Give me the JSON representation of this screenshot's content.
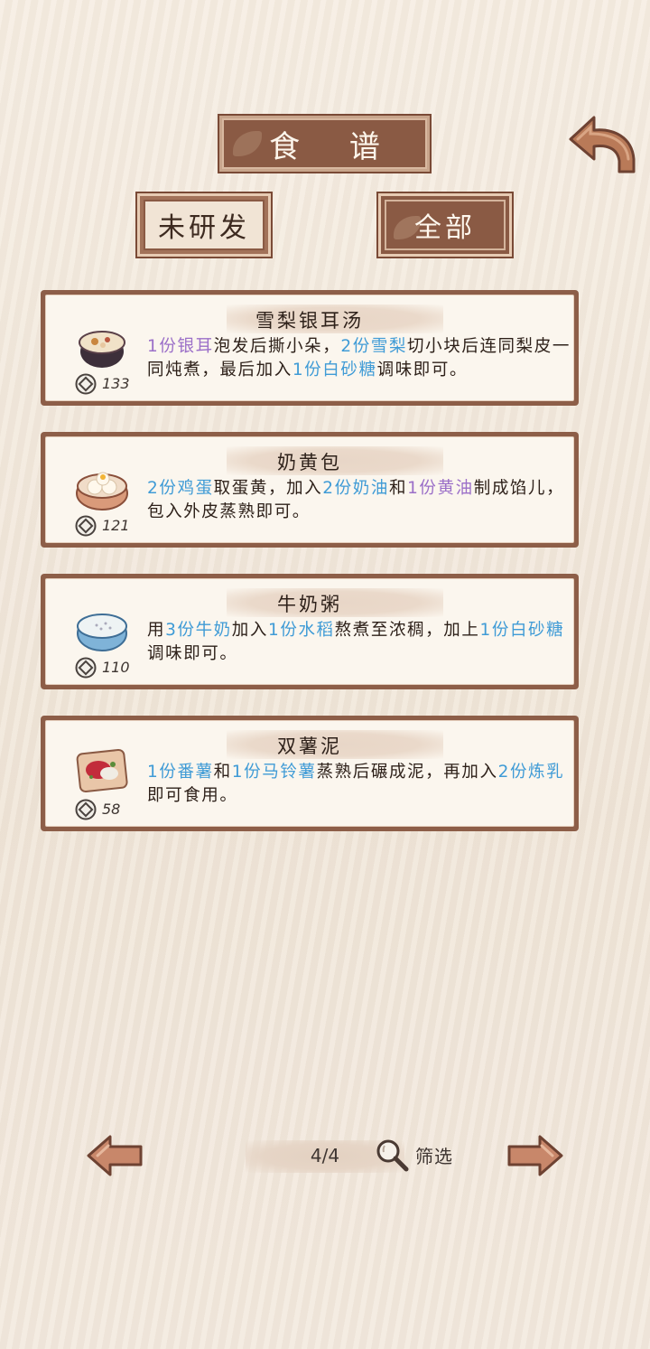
{
  "header": {
    "title": "食 谱",
    "back_icon": "back-arrow-icon"
  },
  "tabs": [
    {
      "label": "未研发",
      "active": false
    },
    {
      "label": "全部",
      "active": true
    }
  ],
  "recipes": [
    {
      "name": "雪梨银耳汤",
      "price": "133",
      "dish_icon": "soup-bowl-icon",
      "desc": [
        {
          "t": "1份银耳",
          "c": "purple"
        },
        {
          "t": "泡发后撕小朵，",
          "c": ""
        },
        {
          "t": "2份雪梨",
          "c": "blue"
        },
        {
          "t": "切小块后连同梨皮一同炖煮，最后加入",
          "c": ""
        },
        {
          "t": "1份白砂糖",
          "c": "blue"
        },
        {
          "t": "调味即可。",
          "c": ""
        }
      ]
    },
    {
      "name": "奶黄包",
      "price": "121",
      "dish_icon": "steamed-bun-icon",
      "desc": [
        {
          "t": "2份鸡蛋",
          "c": "blue"
        },
        {
          "t": "取蛋黄，加入",
          "c": ""
        },
        {
          "t": "2份奶油",
          "c": "blue"
        },
        {
          "t": "和",
          "c": ""
        },
        {
          "t": "1份黄油",
          "c": "purple"
        },
        {
          "t": "制成馅儿，包入外皮蒸熟即可。",
          "c": ""
        }
      ]
    },
    {
      "name": "牛奶粥",
      "price": "110",
      "dish_icon": "porridge-bowl-icon",
      "desc": [
        {
          "t": "用",
          "c": ""
        },
        {
          "t": "3份牛奶",
          "c": "blue"
        },
        {
          "t": "加入",
          "c": ""
        },
        {
          "t": "1份水稻",
          "c": "blue"
        },
        {
          "t": "熬煮至浓稠，加上",
          "c": ""
        },
        {
          "t": "1份白砂糖",
          "c": "blue"
        },
        {
          "t": "调味即可。",
          "c": ""
        }
      ]
    },
    {
      "name": "双薯泥",
      "price": "58",
      "dish_icon": "mashed-potato-plate-icon",
      "desc": [
        {
          "t": "1份番薯",
          "c": "blue"
        },
        {
          "t": "和",
          "c": ""
        },
        {
          "t": "1份马铃薯",
          "c": "blue"
        },
        {
          "t": "蒸熟后碾成泥，再加入",
          "c": ""
        },
        {
          "t": "2份炼乳",
          "c": "blue"
        },
        {
          "t": "即可食用。",
          "c": ""
        }
      ]
    }
  ],
  "pager": {
    "page": "4/4",
    "filter_label": "筛选",
    "prev_icon": "arrow-left-icon",
    "next_icon": "arrow-right-icon",
    "filter_icon": "magnifier-icon"
  },
  "colors": {
    "highlight_purple": "#9b6fc8",
    "highlight_blue": "#3f9bd6",
    "frame_brown": "#8d5e48"
  }
}
